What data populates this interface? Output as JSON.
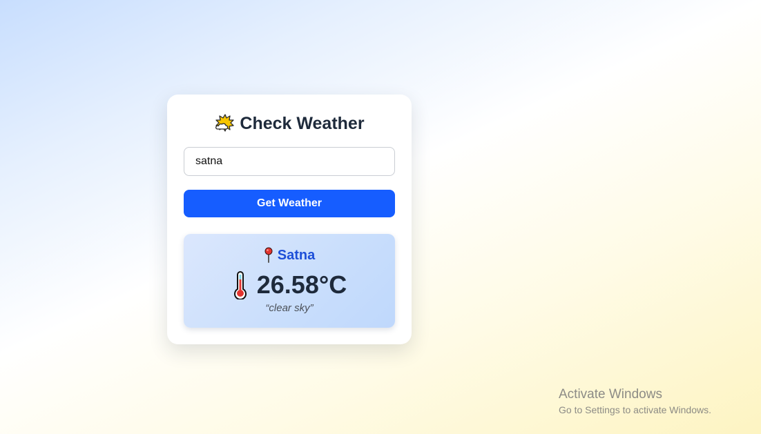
{
  "app": {
    "title": "Check Weather",
    "title_icon": "sun-behind-cloud-icon"
  },
  "search": {
    "value": "satna",
    "placeholder": "Enter city name"
  },
  "actions": {
    "get_weather_label": "Get Weather"
  },
  "result": {
    "pin_icon": "round-pushpin-icon",
    "city": "Satna",
    "thermometer_icon": "thermometer-icon",
    "temperature": "26.58°C",
    "description": "“clear sky”"
  },
  "watermark": {
    "title": "Activate Windows",
    "subtitle": "Go to Settings to activate Windows."
  },
  "colors": {
    "accent": "#165dff",
    "city_text": "#1d4fd8",
    "heading_text": "#1e2a3b"
  }
}
